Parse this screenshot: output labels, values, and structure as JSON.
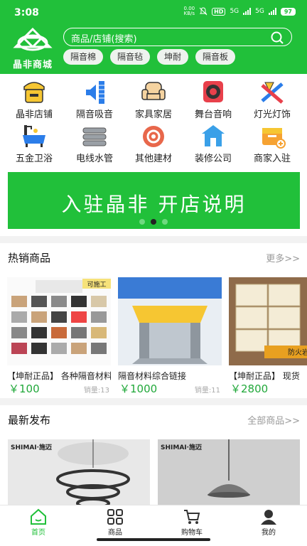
{
  "status_bar": {
    "time": "3:08",
    "net_speed_value": "0.00",
    "net_speed_unit": "KB/s",
    "hd": "HD",
    "network1": "5G",
    "network2": "5G",
    "battery": "97"
  },
  "header": {
    "logo_text": "晶非商城",
    "search_placeholder": "商品/店铺(搜索)",
    "chips": [
      "隔音棉",
      "隔音毡",
      "坤耐",
      "隔音板"
    ]
  },
  "categories": [
    {
      "label": "晶非店铺",
      "icon": "shop-icon"
    },
    {
      "label": "隔音吸音",
      "icon": "speaker-icon"
    },
    {
      "label": "家具家居",
      "icon": "sofa-icon"
    },
    {
      "label": "舞台音响",
      "icon": "stage-speaker-icon"
    },
    {
      "label": "灯光灯饰",
      "icon": "lamp-icon"
    },
    {
      "label": "五金卫浴",
      "icon": "bathtub-icon"
    },
    {
      "label": "电线水管",
      "icon": "pipes-icon"
    },
    {
      "label": "其他建材",
      "icon": "gear-icon"
    },
    {
      "label": "装修公司",
      "icon": "house-icon"
    },
    {
      "label": "商家入驻",
      "icon": "box-icon"
    }
  ],
  "banner": {
    "text": "入驻晶非  开店说明",
    "dots": 3,
    "active_dot": 1
  },
  "hot": {
    "title": "热销商品",
    "more": "更多>>",
    "products": [
      {
        "name": "【坤耐正品】 各种隔音材料",
        "price": "￥100",
        "sales": "销量:13",
        "img_caption": "可施工"
      },
      {
        "name": "隔音材料综合链接",
        "price": "￥1000",
        "sales": "销量:11",
        "img_caption": ""
      },
      {
        "name": "【坤耐正品】 现货",
        "price": "￥2800",
        "sales": "",
        "img_caption": "防火岩"
      }
    ]
  },
  "newest": {
    "title": "最新发布",
    "more": "全部商品>>",
    "cards": [
      {
        "brand": "SHIMAI·施迈"
      },
      {
        "brand": "SHIMAI·施迈"
      }
    ]
  },
  "nav": [
    {
      "label": "首页",
      "icon": "home-icon",
      "active": true
    },
    {
      "label": "商品",
      "icon": "grid-icon",
      "active": false
    },
    {
      "label": "购物车",
      "icon": "cart-icon",
      "active": false
    },
    {
      "label": "我的",
      "icon": "user-icon",
      "active": false
    }
  ],
  "colors": {
    "brand": "#21c03a",
    "price": "#21a83a"
  }
}
